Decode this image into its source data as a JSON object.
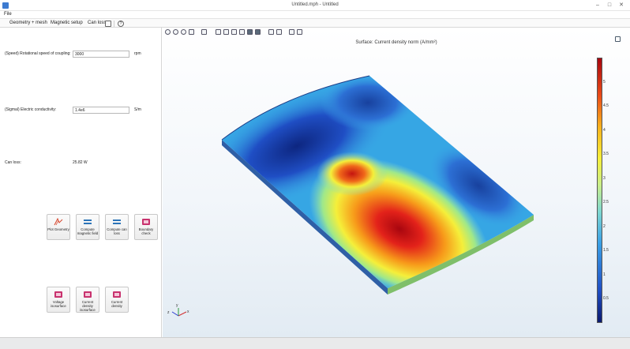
{
  "window": {
    "title": "Untitled.mph - Untitled",
    "minimize_glyph": "–",
    "maximize_glyph": "□",
    "close_glyph": "✕"
  },
  "menu": {
    "file": "File"
  },
  "tabs": [
    {
      "label": "Geometry + mesh"
    },
    {
      "label": "Magnetic setup"
    },
    {
      "label": "Can loss"
    }
  ],
  "params": {
    "speed": {
      "label": "(Speed) Rotational speed of coupling:",
      "value": "3000",
      "unit": "rpm"
    },
    "sigma": {
      "label": "(Sigmal) Electric conductivity:",
      "value": "1.4e6",
      "unit": "S/m"
    },
    "canloss": {
      "label": "Can loss:",
      "value": "25.82 W"
    }
  },
  "buttons_row1": [
    {
      "label": "Plot Geometry",
      "icon": "plot-geometry-icon"
    },
    {
      "label": "Compute magnetic field",
      "icon": "compute-icon"
    },
    {
      "label": "Compute can loss",
      "icon": "compute-icon"
    },
    {
      "label": "Boundary check",
      "icon": "plot-icon"
    }
  ],
  "buttons_row2": [
    {
      "label": "Voltage isosurface",
      "icon": "plot-icon"
    },
    {
      "label": "Current density isosurface",
      "icon": "plot-icon"
    },
    {
      "label": "Current density",
      "icon": "plot-icon"
    }
  ],
  "plot": {
    "title": "Surface: Current density norm (A/mm²)",
    "colorbar_ticks": [
      "5",
      "4.5",
      "4",
      "3.5",
      "3",
      "2.5",
      "2",
      "1.5",
      "1",
      "0.5"
    ],
    "colorbar_range": [
      0,
      5.5
    ],
    "axes": {
      "x": "x",
      "y": "y",
      "z": "z"
    },
    "colors": {
      "high": "#a8060f",
      "mid": "#f5ef3a",
      "low": "#0b1a6e"
    }
  }
}
